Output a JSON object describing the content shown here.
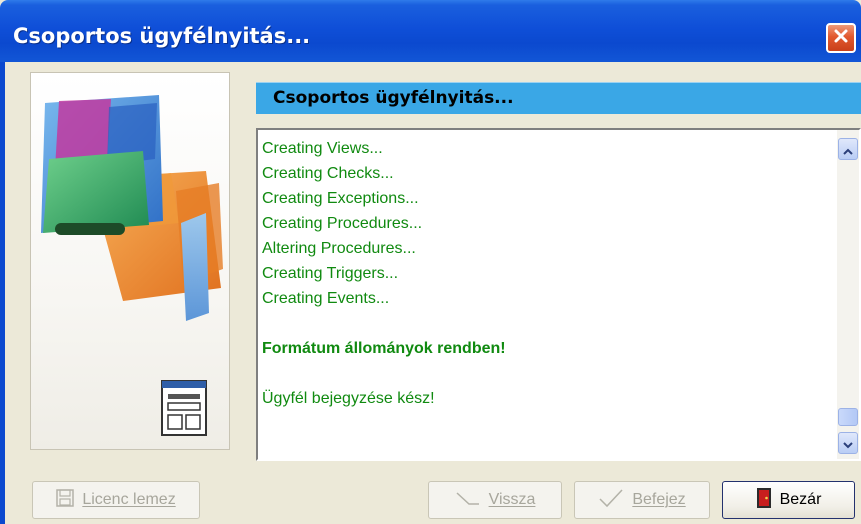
{
  "window": {
    "title": "Csoportos ügyfélnyitás..."
  },
  "header": {
    "title": "Csoportos ügyfélnyitás..."
  },
  "log": {
    "lines": [
      "Creating Views...",
      "Creating Checks...",
      "Creating Exceptions...",
      "Creating Procedures...",
      "Altering Procedures...",
      "Creating Triggers...",
      "Creating Events..."
    ],
    "status_ok": "Formátum állományok rendben!",
    "status_done": "Ügyfél bejegyzése kész!"
  },
  "buttons": {
    "licenc": "Licenc lemez",
    "back": "Vissza",
    "finish": "Befejez",
    "close": "Bezár"
  },
  "colors": {
    "title_bar": "#0B49CF",
    "banner": "#3AA7E6",
    "log_text": "#108A10"
  },
  "icons": [
    "close-icon",
    "wizard-graphic",
    "form-window-icon",
    "floppy-disk-icon",
    "back-arrow-icon",
    "checkmark-icon",
    "door-exit-icon",
    "scroll-up-icon",
    "scroll-down-icon"
  ]
}
